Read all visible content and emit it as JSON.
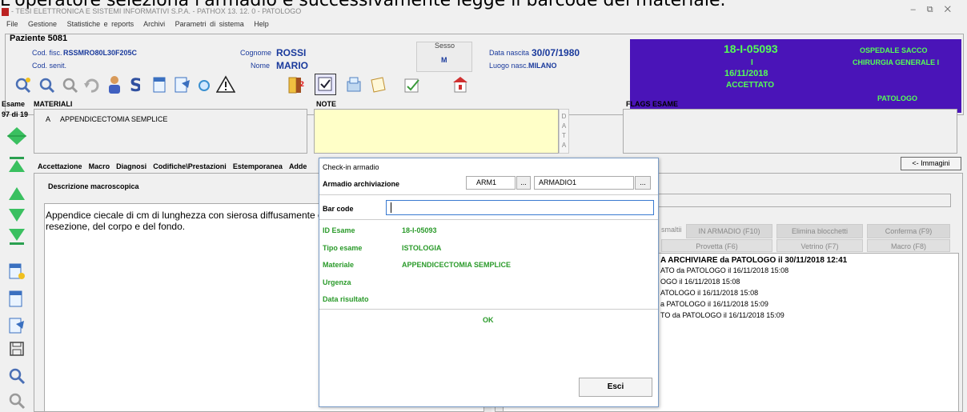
{
  "caption": "L'operatore seleziona l'armadio e successivamente legge il barcode del materiale.",
  "window": {
    "title": "- TESI ELETTRONICA E SISTEMI INFORMATIVI S.P.A. - PATHOX 13. 12. 0 - PATOLOGO",
    "minimize": "–",
    "maximize": "⧉",
    "close": "✕"
  },
  "menu": [
    "File",
    "Gestione",
    "Statistiche e reports",
    "Archivi",
    "Parametri di sistema",
    "Help"
  ],
  "patient": {
    "header": "Paziente 5081",
    "cod_fisc_label": "Cod. fisc.",
    "cod_fisc": "RSSMRO80L30F205C",
    "cod_senit_label": "Cod. senit.",
    "cognome_label": "Cognome",
    "cognome": "ROSSI",
    "nome_label": "Nome",
    "nome": "MARIO",
    "sesso_label": "Sesso",
    "sesso": "M",
    "data_nascita_label": "Data nascita",
    "data_nascita": "30/07/1980",
    "luogo_nasc_label": "Luogo nasc.",
    "luogo_nasc": "MILANO"
  },
  "exam_card": {
    "id": "18-I-05093",
    "type": "I",
    "date": "16/11/2018",
    "status": "ACCETTATO",
    "hospital": "OSPEDALE SACCO",
    "department": "CHIRURGIA GENERALE I",
    "role": "PATOLOGO"
  },
  "exam_counter": {
    "label": "Esame",
    "value": "97 di 19"
  },
  "materiali": {
    "label": "MATERIALI",
    "code": "A",
    "text": "APPENDICECTOMIA SEMPLICE"
  },
  "note": {
    "label": "NOTE",
    "data_letters": [
      "D",
      "A",
      "T",
      "A"
    ]
  },
  "flags": {
    "label": "FLAGS ESAME"
  },
  "tabs": [
    "Accettazione",
    "Macro",
    "Diagnosi",
    "Codifiche\\Prestazioni",
    "Estemporanea",
    "Adde"
  ],
  "immagini_button": "<- Immagini",
  "macro": {
    "label": "Descrizione macroscopica",
    "text_line1": "Appendice ciecale di cm di lunghezza con sierosa diffusamente o",
    "text_line2": "resezione, del corpo e del fondo."
  },
  "right_buttons": {
    "smaltiti": "smaltii",
    "in_armadio": "IN ARMADIO (F10)",
    "elimina": "Elimina blocchetti",
    "conferma": "Conferma (F9)",
    "provetta": "Provetta (F6)",
    "vetrino": "Vetrino (F7)",
    "macro": "Macro (F8)"
  },
  "log": [
    "A ARCHIVIARE da PATOLOGO il 30/11/2018 12:41",
    "ATO da PATOLOGO il 16/11/2018 15:08",
    "OGO il 16/11/2018 15:08",
    "ATOLOGO il 16/11/2018 15:08",
    "a PATOLOGO il 16/11/2018 15:09",
    "TO da PATOLOGO il 16/11/2018 15:09"
  ],
  "modal": {
    "title": "Check-in armadio",
    "armadio_label": "Armadio archiviazione",
    "armadio_code": "ARM1",
    "armadio_name": "ARMADIO1",
    "ellipsis": "...",
    "barcode_label": "Bar code",
    "barcode_value": "",
    "id_esame_label": "ID Esame",
    "id_esame": "18-I-05093",
    "tipo_esame_label": "Tipo esame",
    "tipo_esame": "ISTOLOGIA",
    "materiale_label": "Materiale",
    "materiale": "APPENDICECTOMIA SEMPLICE",
    "urgenza_label": "Urgenza",
    "data_risultato_label": "Data risultato",
    "status": "OK",
    "close_button": "Esci"
  }
}
